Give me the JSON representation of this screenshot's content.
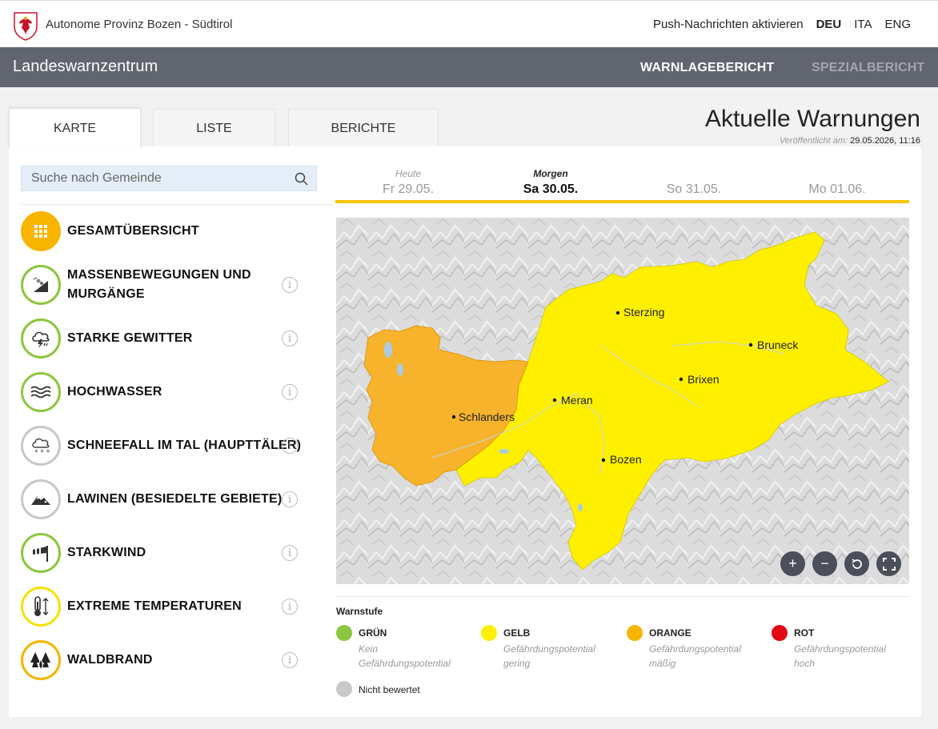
{
  "header": {
    "org_name": "Autonome Provinz Bozen - Südtirol",
    "push_label": "Push-Nachrichten aktivieren",
    "languages": [
      "DEU",
      "ITA",
      "ENG"
    ],
    "active_language": "DEU"
  },
  "navbar": {
    "brand": "Landeswarnzentrum",
    "links": [
      "WARNLAGEBERICHT",
      "SPEZIALBERICHT"
    ]
  },
  "tabs": [
    "KARTE",
    "LISTE",
    "BERICHTE"
  ],
  "page": {
    "title": "Aktuelle Warnungen",
    "published_label": "Veröffentlicht am:",
    "published_value": "29.05.2026, 11:16"
  },
  "search": {
    "placeholder": "Suche nach Gemeinde"
  },
  "categories": [
    {
      "label": "GESAMTÜBERSICHT",
      "icon": "grid-icon",
      "level_color": "#f7b500"
    },
    {
      "label": "MASSENBEWEGUNGEN UND MURGÄNGE",
      "icon": "landslide-icon",
      "level_color": "#8cc63f"
    },
    {
      "label": "STARKE GEWITTER",
      "icon": "thunderstorm-icon",
      "level_color": "#8cc63f"
    },
    {
      "label": "HOCHWASSER",
      "icon": "flood-icon",
      "level_color": "#8cc63f"
    },
    {
      "label": "SCHNEEFALL IM TAL (HAUPTTÄLER)",
      "icon": "snowfall-icon",
      "level_color": "#c8c8c8"
    },
    {
      "label": "LAWINEN (BESIEDELTE GEBIETE)",
      "icon": "avalanche-icon",
      "level_color": "#c8c8c8"
    },
    {
      "label": "STARKWIND",
      "icon": "windsock-icon",
      "level_color": "#8cc63f"
    },
    {
      "label": "EXTREME TEMPERATUREN",
      "icon": "thermometer-icon",
      "level_color": "#f5e200"
    },
    {
      "label": "WALDBRAND",
      "icon": "forest-fire-icon",
      "level_color": "#f7b500"
    }
  ],
  "days": [
    {
      "label": "Heute",
      "date": "Fr 29.05."
    },
    {
      "label": "Morgen",
      "date": "Sa 30.05."
    },
    {
      "label": "",
      "date": "So 31.05."
    },
    {
      "label": "",
      "date": "Mo 01.06."
    }
  ],
  "selected_day": 1,
  "map": {
    "cities": [
      "Sterzing",
      "Bruneck",
      "Brixen",
      "Meran",
      "Schlanders",
      "Bozen"
    ],
    "controls": [
      "zoom-in-icon",
      "zoom-out-icon",
      "reset-icon",
      "fullscreen-icon"
    ]
  },
  "legend": {
    "title": "Warnstufe",
    "levels": [
      {
        "name": "GRÜN",
        "desc": "Kein Gefährdungspotential",
        "color": "#8cc63f"
      },
      {
        "name": "GELB",
        "desc": "Gefährdungspotential gering",
        "color": "#ffef00"
      },
      {
        "name": "ORANGE",
        "desc": "Gefährdungspotential mäßig",
        "color": "#f7b500"
      },
      {
        "name": "ROT",
        "desc": "Gefährdungspotential hoch",
        "color": "#e30613"
      }
    ],
    "not_rated": "Nicht bewertet"
  }
}
